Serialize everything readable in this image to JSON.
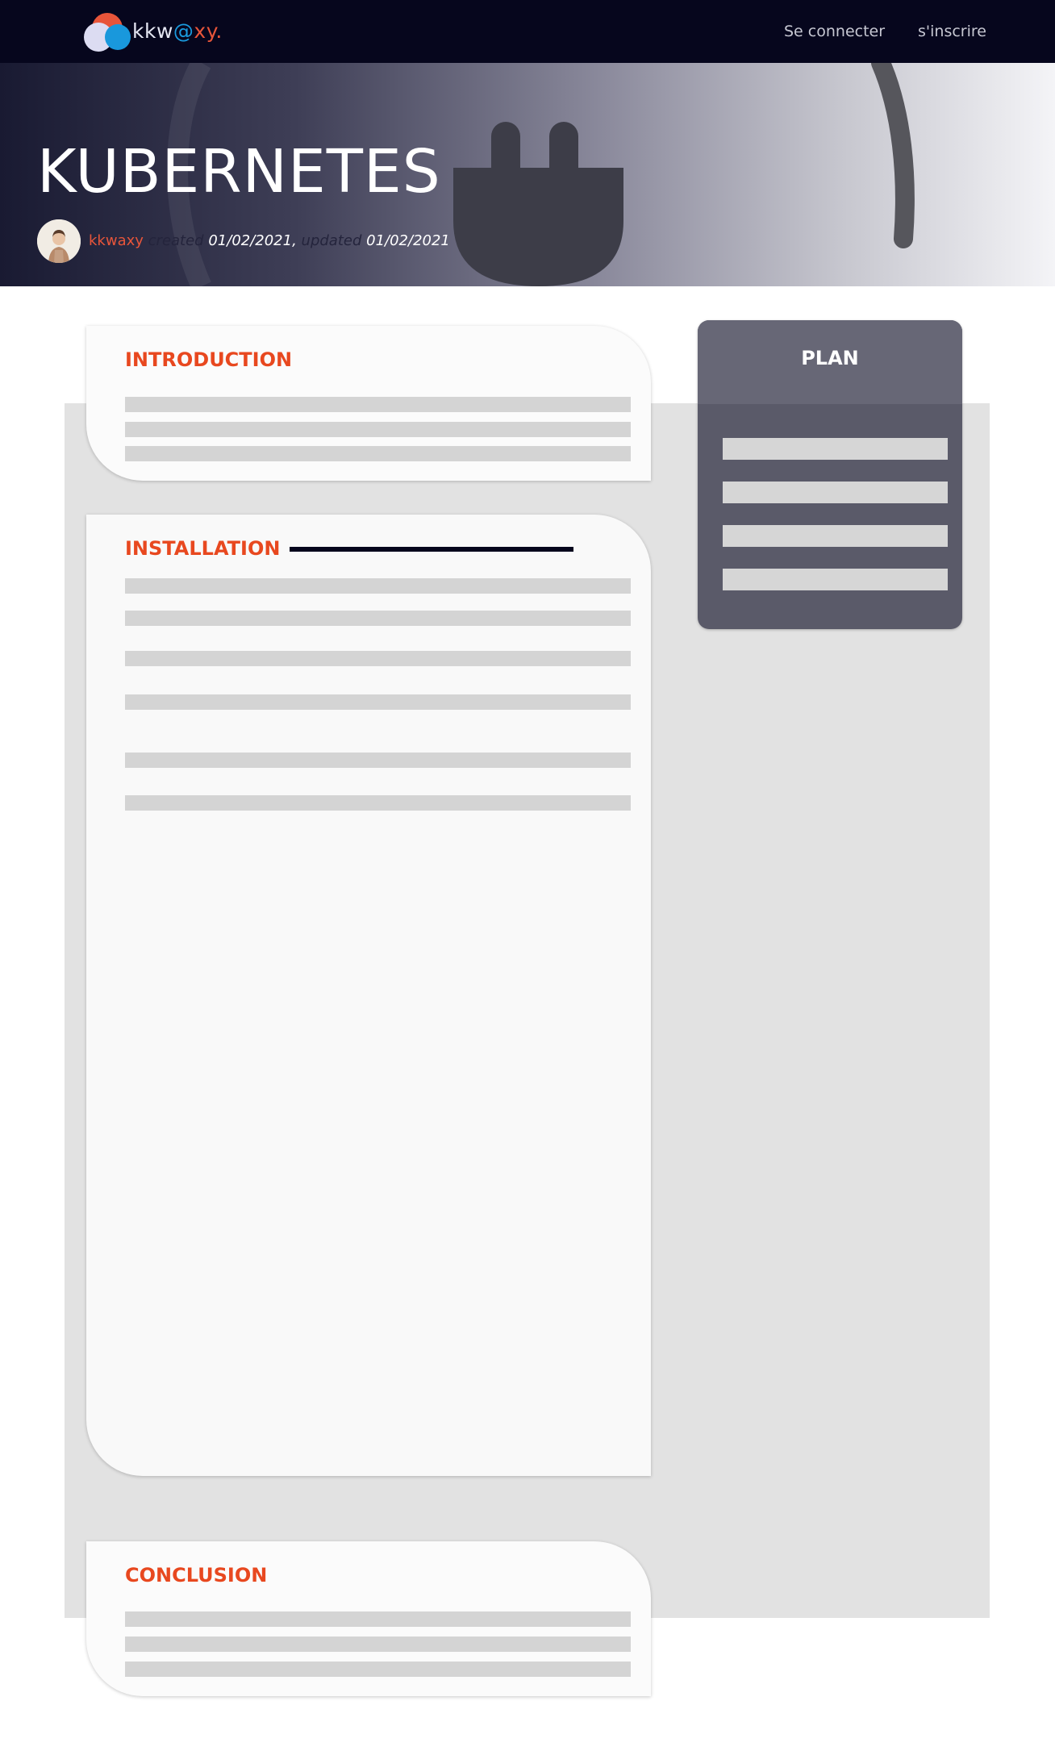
{
  "nav": {
    "logo": {
      "part1": "kkw",
      "part2": "@",
      "part3": "xy."
    },
    "login": "Se connecter",
    "signup": "s'inscrire"
  },
  "hero": {
    "title": "KUBERNETES",
    "author": "kkwaxy",
    "created_label": "created",
    "created_date": "01/02/2021,",
    "updated_label": "updated",
    "updated_date": "01/02/2021"
  },
  "sections": {
    "introduction": "INTRODUCTION",
    "installation": "INSTALLATION",
    "conclusion": "CONCLUSION"
  },
  "plan": {
    "title": "PLAN",
    "item_count": 4
  },
  "colors": {
    "accent": "#e8481f",
    "nav_bg": "#06061d",
    "logo_blue": "#1a9bdf",
    "plan_bg": "#5a5a69",
    "content_bg": "#e2e2e2"
  },
  "icons": [
    "logo-circles-icon",
    "plug-icon",
    "avatar"
  ]
}
